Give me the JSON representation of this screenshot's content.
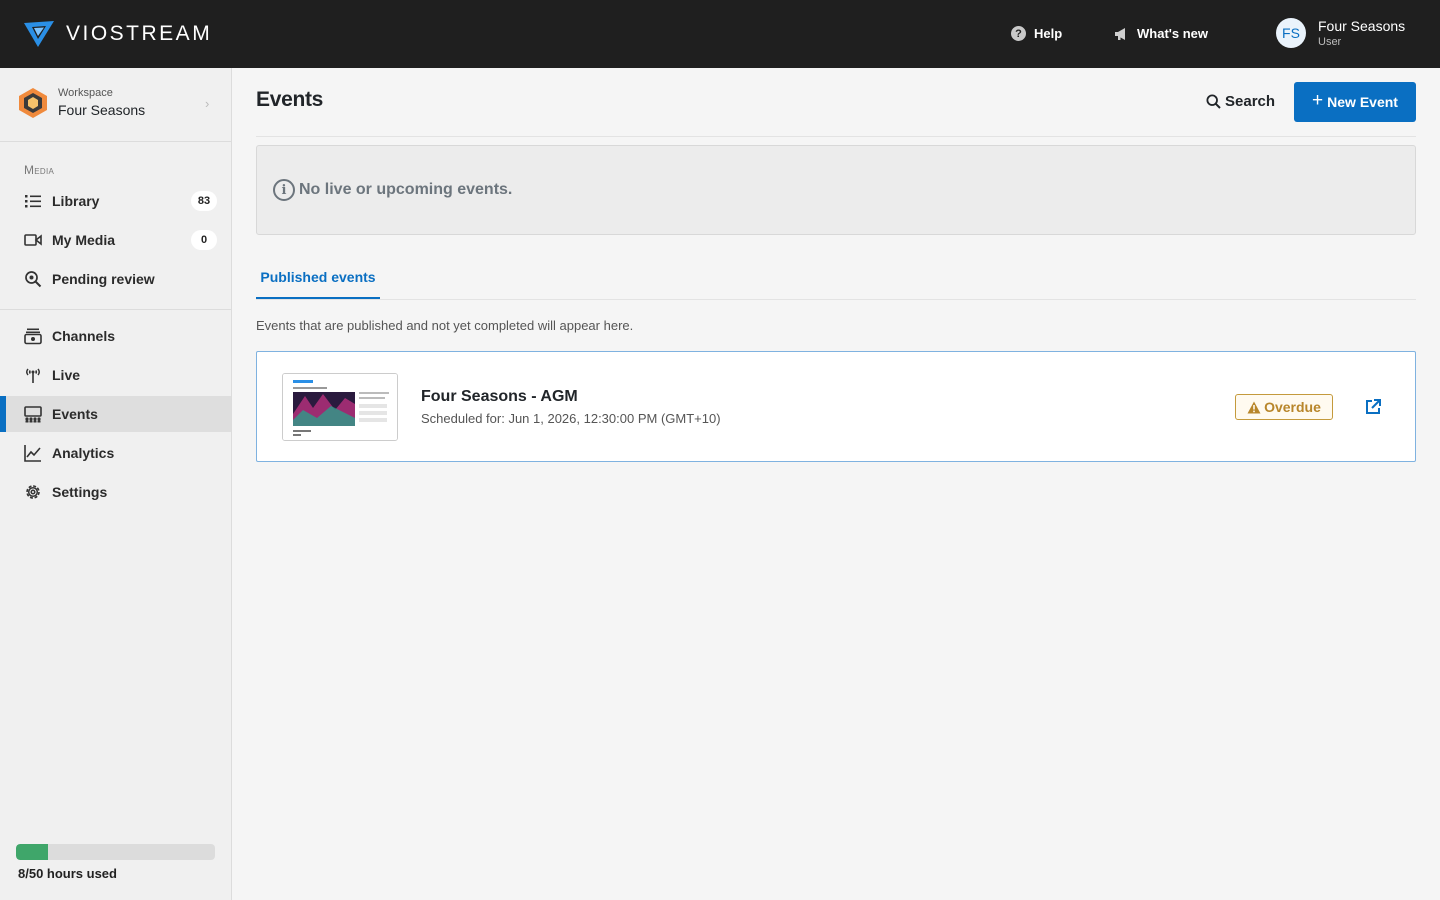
{
  "app": {
    "brand": "VIOSTREAM"
  },
  "topbar": {
    "help_label": "Help",
    "whats_new_label": "What's new",
    "user": {
      "initials": "FS",
      "name": "Four Seasons",
      "role": "User"
    }
  },
  "sidebar": {
    "workspace_label": "Workspace",
    "workspace_name": "Four Seasons",
    "section_media": "Media",
    "items": [
      {
        "label": "Library",
        "icon": "list-icon",
        "count": "83"
      },
      {
        "label": "My Media",
        "icon": "video-camera-icon",
        "count": "0"
      },
      {
        "label": "Pending review",
        "icon": "search-review-icon"
      },
      {
        "label": "Channels",
        "icon": "channels-icon"
      },
      {
        "label": "Live",
        "icon": "broadcast-icon"
      },
      {
        "label": "Events",
        "icon": "events-icon",
        "active": true
      },
      {
        "label": "Analytics",
        "icon": "chart-icon"
      },
      {
        "label": "Settings",
        "icon": "gear-icon"
      }
    ],
    "usage": {
      "text": "8/50 hours used",
      "used": 8,
      "total": 50
    }
  },
  "main": {
    "title": "Events",
    "search_label": "Search",
    "new_event_label": "New Event",
    "notice": "No live or upcoming events.",
    "tabs": [
      {
        "label": "Published events",
        "active": true
      }
    ],
    "description": "Events that are published and not yet completed will appear here.",
    "events": [
      {
        "title": "Four Seasons - AGM",
        "scheduled": "Scheduled for: Jun 1, 2026, 12:30:00 PM (GMT+10)",
        "status": "Overdue"
      }
    ]
  },
  "colors": {
    "accent": "#0a6fc2",
    "topbar": "#1f1f1f",
    "usage": "#3fa66a",
    "warning": "#b8862b"
  }
}
